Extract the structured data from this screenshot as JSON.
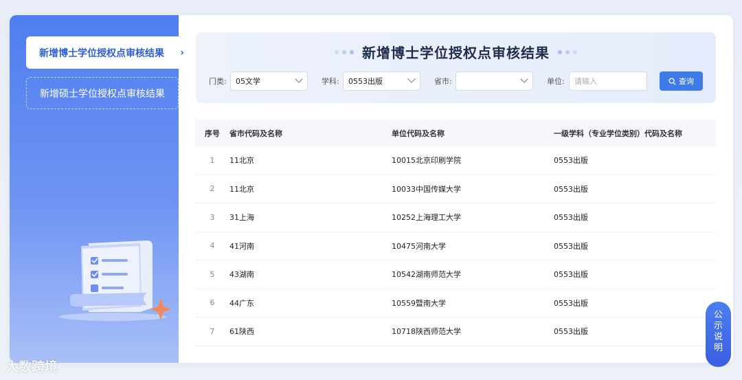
{
  "sidebar": {
    "items": [
      {
        "label": "新增博士学位授权点审核结果"
      },
      {
        "label": "新增硕士学位授权点审核结果"
      }
    ]
  },
  "panel": {
    "title": "新增博士学位授权点审核结果",
    "filters": {
      "category_label": "门类:",
      "category_value": "05文学",
      "subject_label": "学科:",
      "subject_value": "0553出版",
      "province_label": "省市:",
      "province_value": "",
      "unit_label": "单位:",
      "unit_placeholder": "请输入"
    },
    "query_label": "查询"
  },
  "table": {
    "headers": [
      "序号",
      "省市代码及名称",
      "单位代码及名称",
      "一级学科（专业学位类别）代码及名称"
    ],
    "rows": [
      [
        "1",
        "11北京",
        "10015北京印刷学院",
        "0553出版"
      ],
      [
        "2",
        "11北京",
        "10033中国传媒大学",
        "0553出版"
      ],
      [
        "3",
        "31上海",
        "10252上海理工大学",
        "0553出版"
      ],
      [
        "4",
        "41河南",
        "10475河南大学",
        "0553出版"
      ],
      [
        "5",
        "43湖南",
        "10542湖南师范大学",
        "0553出版"
      ],
      [
        "6",
        "44广东",
        "10559暨南大学",
        "0553出版"
      ],
      [
        "7",
        "61陕西",
        "10718陕西师范大学",
        "0553出版"
      ]
    ]
  },
  "notice_button": [
    "公",
    "示",
    "说",
    "明"
  ],
  "watermark": "大数跨境",
  "colors": {
    "accent": "#3e7be8",
    "sidebar_top": "#4f7ef0"
  }
}
